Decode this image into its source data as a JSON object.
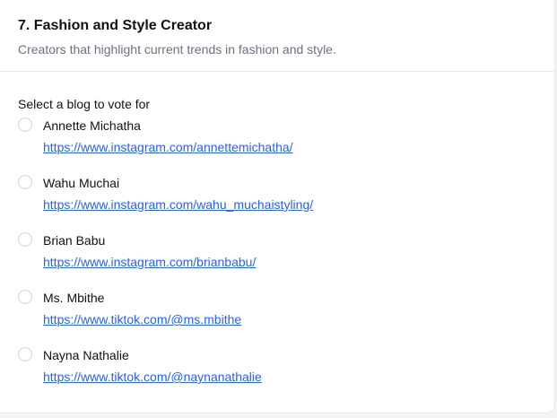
{
  "header": {
    "title": "7. Fashion and Style Creator",
    "subtitle": "Creators that highlight current trends in fashion and style."
  },
  "poll": {
    "prompt": "Select a blog to vote for",
    "options": [
      {
        "name": "Annette Michatha",
        "link": "https://www.instagram.com/annettemichatha/"
      },
      {
        "name": "Wahu Muchai",
        "link": "https://www.instagram.com/wahu_muchaistyling/"
      },
      {
        "name": "Brian Babu",
        "link": "https://www.instagram.com/brianbabu/"
      },
      {
        "name": "Ms. Mbithe",
        "link": "https://www.tiktok.com/@ms.mbithe"
      },
      {
        "name": "Nayna Nathalie",
        "link": "https://www.tiktok.com/@naynanathalie"
      }
    ]
  },
  "colors": {
    "link": "#2563eb",
    "muted_text": "#6b7280",
    "border": "#e5e7eb"
  }
}
